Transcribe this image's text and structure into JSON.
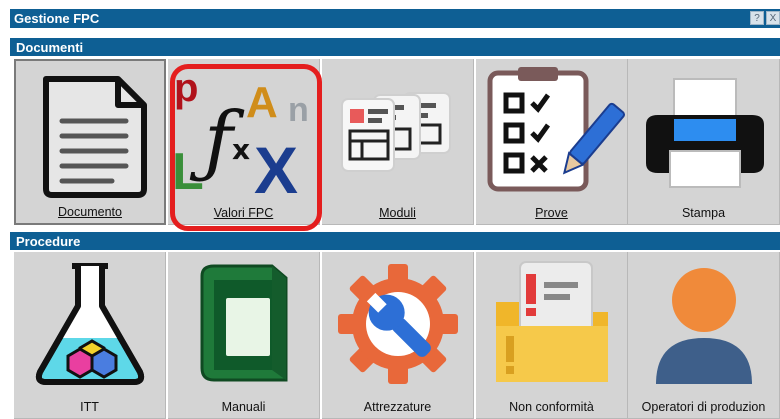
{
  "window": {
    "title": "Gestione FPC",
    "help_glyph": "?",
    "close_glyph": "X"
  },
  "sections": {
    "documenti": {
      "title": "Documenti",
      "items": [
        {
          "label": "Documento",
          "icon": "document-icon"
        },
        {
          "label": "Valori FPC",
          "icon": "formula-icon"
        },
        {
          "label": "Moduli",
          "icon": "forms-icon"
        },
        {
          "label": "Prove",
          "icon": "checklist-icon"
        },
        {
          "label": "Stampa",
          "icon": "printer-icon"
        }
      ]
    },
    "procedure": {
      "title": "Procedure",
      "items": [
        {
          "label": "ITT",
          "icon": "flask-icon"
        },
        {
          "label": "Manuali",
          "icon": "book-icon"
        },
        {
          "label": "Attrezzature",
          "icon": "wrench-gear-icon"
        },
        {
          "label": "Non conformità",
          "icon": "folder-alert-icon"
        },
        {
          "label": "Operatori di produzion",
          "icon": "user-icon"
        }
      ]
    }
  },
  "colors": {
    "header_bar": "#0e5f94",
    "tile_bg": "#d4d4d4",
    "highlight_border": "#e41e1e"
  }
}
